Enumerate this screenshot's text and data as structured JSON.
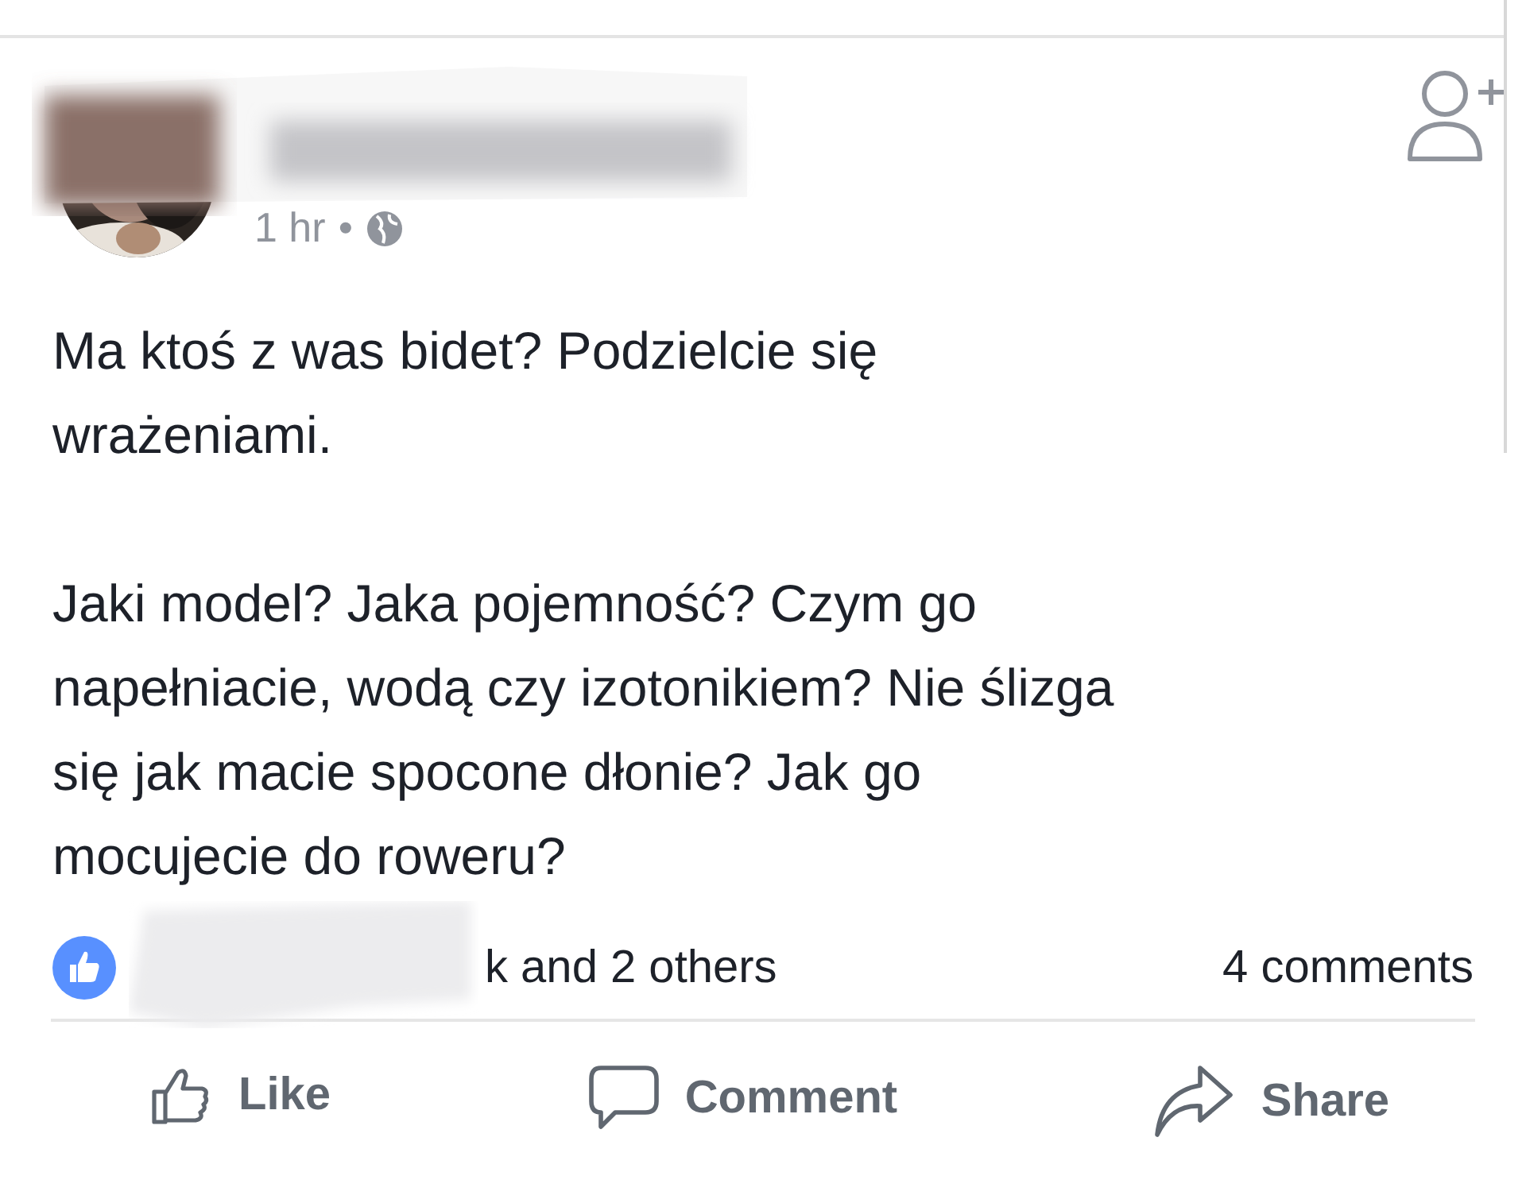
{
  "post": {
    "timestamp": "1 hr",
    "separator": "•",
    "paragraphs": [
      [
        "Ma ktoś z was bidet? Podzielcie się",
        "wrażeniami."
      ],
      [
        "Jaki model? Jaka pojemność? Czym go",
        "napełniacie, wodą czy izotonikiem? Nie ślizga",
        "się jak macie spocone dłonie? Jak go",
        "mocujecie do roweru?"
      ]
    ]
  },
  "reactions": {
    "summary": "k and 2 others",
    "comments": "4 comments"
  },
  "actions": [
    {
      "label": "Like",
      "kind": "like"
    },
    {
      "label": "Comment",
      "kind": "comment"
    },
    {
      "label": "Share",
      "kind": "share"
    }
  ]
}
